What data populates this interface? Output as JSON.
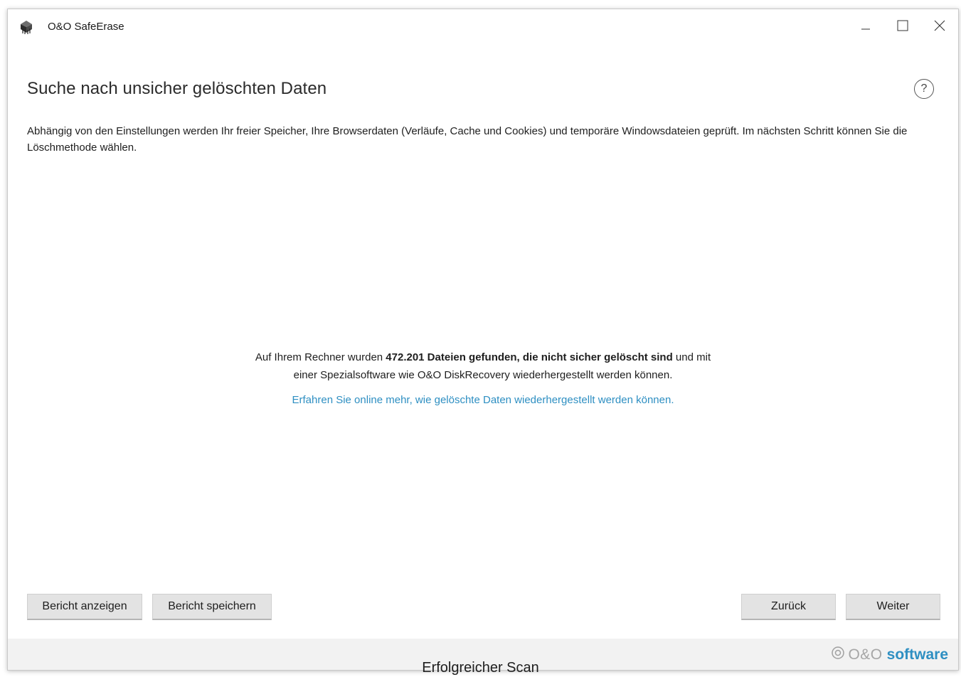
{
  "window": {
    "title": "O&O SafeErase",
    "controls": {
      "minimize": "_",
      "maximize": "☐",
      "close": "✕"
    }
  },
  "page": {
    "title": "Suche nach unsicher gelöschten Daten",
    "help_label": "?",
    "description": "Abhängig von den Einstellungen werden Ihr freier Speicher, Ihre Browserdaten (Verläufe, Cache und Cookies) und temporäre Windowsdateien geprüft. Im nächsten Schritt können Sie die Löschmethode wählen."
  },
  "result": {
    "prefix": "Auf Ihrem Rechner wurden ",
    "highlight": "472.201 Dateien gefunden, die nicht sicher gelöscht sind",
    "suffix_line1": " und mit",
    "line2": "einer Spezialsoftware wie O&O DiskRecovery wiederhergestellt werden können.",
    "link": "Erfahren Sie online mehr, wie gelöschte Daten wiederhergestellt werden können."
  },
  "buttons": {
    "report_show": "Bericht anzeigen",
    "report_save": "Bericht speichern",
    "back": "Zurück",
    "next": "Weiter"
  },
  "footer": {
    "brand_mark": "@",
    "brand_name": "O&O",
    "brand_bold": "software"
  },
  "caption": "Erfolgreicher Scan",
  "colors": {
    "accent": "#2e8fc2",
    "button_bg": "#e3e3e3",
    "footer_bg": "#f2f2f2"
  },
  "icons": {
    "app": "safeerase-shredder-icon",
    "help": "help-circle-icon",
    "minimize": "minimize-icon",
    "maximize": "maximize-icon",
    "close": "close-icon",
    "brand": "oo-logo-icon"
  }
}
